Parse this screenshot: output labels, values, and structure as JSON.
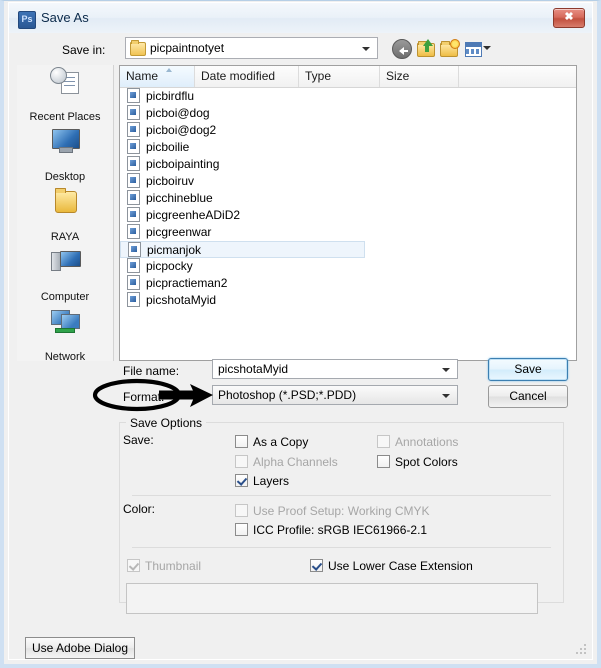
{
  "window": {
    "title": "Save As",
    "app_icon": "photoshop-icon",
    "close_label": "✖",
    "frame_color": "#cfe0f2"
  },
  "toolbar": {
    "save_in_label": "Save in:",
    "save_in_value": "picpaintnotyet",
    "buttons": [
      {
        "name": "back-button",
        "icon": "back-arrow-icon"
      },
      {
        "name": "up-one-level-button",
        "icon": "folder-up-icon"
      },
      {
        "name": "new-folder-button",
        "icon": "new-folder-icon"
      },
      {
        "name": "views-button",
        "icon": "views-grid-icon"
      }
    ]
  },
  "places": [
    {
      "label": "Recent Places",
      "icon": "recent-places-icon"
    },
    {
      "label": "Desktop",
      "icon": "desktop-icon"
    },
    {
      "label": "RAYA",
      "icon": "folder-icon"
    },
    {
      "label": "Computer",
      "icon": "computer-icon"
    },
    {
      "label": "Network",
      "icon": "network-icon"
    }
  ],
  "file_list": {
    "columns": [
      "Name",
      "Date modified",
      "Type",
      "Size"
    ],
    "sorted_by": "Name",
    "sort_direction": "ascending",
    "selected": "picmanjok",
    "files": [
      "picbirdflu",
      "picboi@dog",
      "picboi@dog2",
      "picboilie",
      "picboipainting",
      "picboiruv",
      "picchineblue",
      "picgreenheADiD2",
      "picgreenwar",
      "picmanjok",
      "picpocky",
      "picpractieman2",
      "picshotaMyid"
    ]
  },
  "form": {
    "file_name_label": "File name:",
    "file_name_value": "picshotaMyid",
    "format_label": "Format:",
    "format_value": "Photoshop (*.PSD;*.PDD)",
    "save_button": "Save",
    "cancel_button": "Cancel"
  },
  "save_options": {
    "group_title": "Save Options",
    "save_label": "Save:",
    "color_label": "Color:",
    "checkboxes": [
      {
        "label": "As a Copy",
        "checked": false,
        "disabled": false
      },
      {
        "label": "Annotations",
        "checked": false,
        "disabled": true
      },
      {
        "label": "Alpha Channels",
        "checked": false,
        "disabled": true
      },
      {
        "label": "Spot Colors",
        "checked": false,
        "disabled": false
      },
      {
        "label": "Layers",
        "checked": true,
        "disabled": false
      },
      {
        "label": "Use Proof Setup:  Working CMYK",
        "checked": false,
        "disabled": true
      },
      {
        "label": "ICC Profile:  sRGB IEC61966-2.1",
        "checked": false,
        "disabled": false
      },
      {
        "label": "Thumbnail",
        "checked": true,
        "disabled": true
      },
      {
        "label": "Use Lower Case Extension",
        "checked": true,
        "disabled": false
      }
    ]
  },
  "footer": {
    "adobe_dialog_button": "Use Adobe Dialog"
  },
  "annotation": {
    "type": "hand-drawn-ellipse-with-arrow",
    "targets": "Format:",
    "color": "#000000"
  }
}
